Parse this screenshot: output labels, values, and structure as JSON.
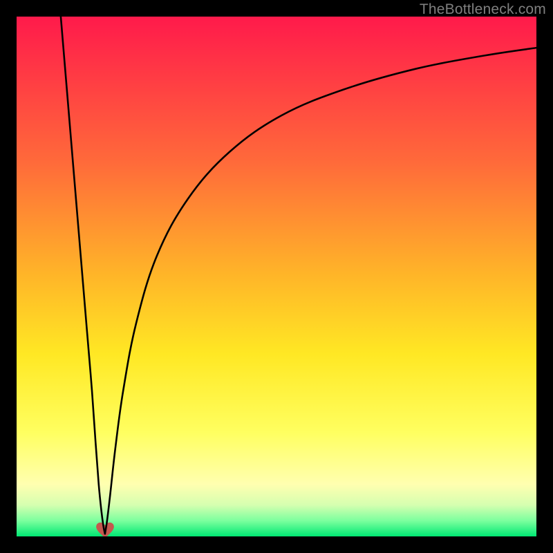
{
  "watermark": {
    "text": "TheBottleneck.com"
  },
  "chart_data": {
    "type": "line",
    "title": "",
    "xlabel": "",
    "ylabel": "",
    "xlim": [
      0,
      100
    ],
    "ylim": [
      0,
      100
    ],
    "grid": false,
    "legend": false,
    "background_gradient_stops": [
      {
        "pct": 0.0,
        "color": "#ff1a4b"
      },
      {
        "pct": 28.0,
        "color": "#ff6a3a"
      },
      {
        "pct": 50.0,
        "color": "#ffb628"
      },
      {
        "pct": 65.0,
        "color": "#ffe824"
      },
      {
        "pct": 80.0,
        "color": "#ffff60"
      },
      {
        "pct": 90.0,
        "color": "#ffffb0"
      },
      {
        "pct": 94.0,
        "color": "#d5ffb0"
      },
      {
        "pct": 97.0,
        "color": "#7bff9e"
      },
      {
        "pct": 100.0,
        "color": "#00e873"
      }
    ],
    "series": [
      {
        "name": "left-branch",
        "x": [
          8.5,
          9.5,
          10.5,
          11.5,
          12.5,
          13.5,
          14.5,
          15.2,
          15.8,
          16.3,
          16.7,
          17.0
        ],
        "y": [
          100,
          88,
          76,
          64,
          52,
          40,
          28,
          18,
          10,
          5,
          2,
          0.5
        ]
      },
      {
        "name": "right-branch",
        "x": [
          17.0,
          17.4,
          18.0,
          19.0,
          20.5,
          23.0,
          27.0,
          33.0,
          41.0,
          51.0,
          63.0,
          77.0,
          90.0,
          100.0
        ],
        "y": [
          0.5,
          3,
          8,
          17,
          28,
          41,
          54,
          65,
          74,
          81,
          86,
          90,
          92.5,
          94.0
        ]
      }
    ],
    "annotations": [
      {
        "name": "heart-marker",
        "x": 17.0,
        "y": 1.2,
        "symbol": "heart",
        "color": "#c5584e"
      }
    ]
  }
}
